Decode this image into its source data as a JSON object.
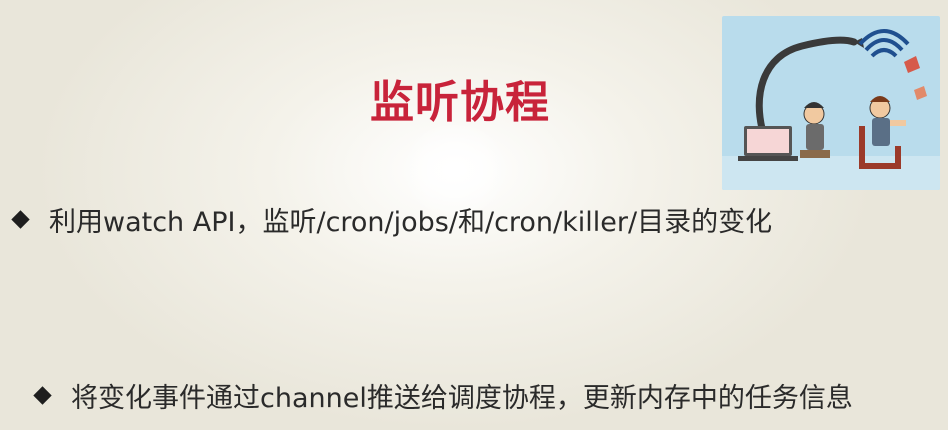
{
  "slide": {
    "title": "监听协程",
    "bullets": [
      "利用watch API，监听/cron/jobs/和/cron/killer/目录的变化",
      "将变化事件通过channel推送给调度协程，更新内存中的任务信息"
    ],
    "illustration": {
      "icon": "eavesdropping-cartoon",
      "background_color": "#b9dcec"
    },
    "colors": {
      "title": "#c8233a",
      "text": "#2a2a2a"
    }
  }
}
